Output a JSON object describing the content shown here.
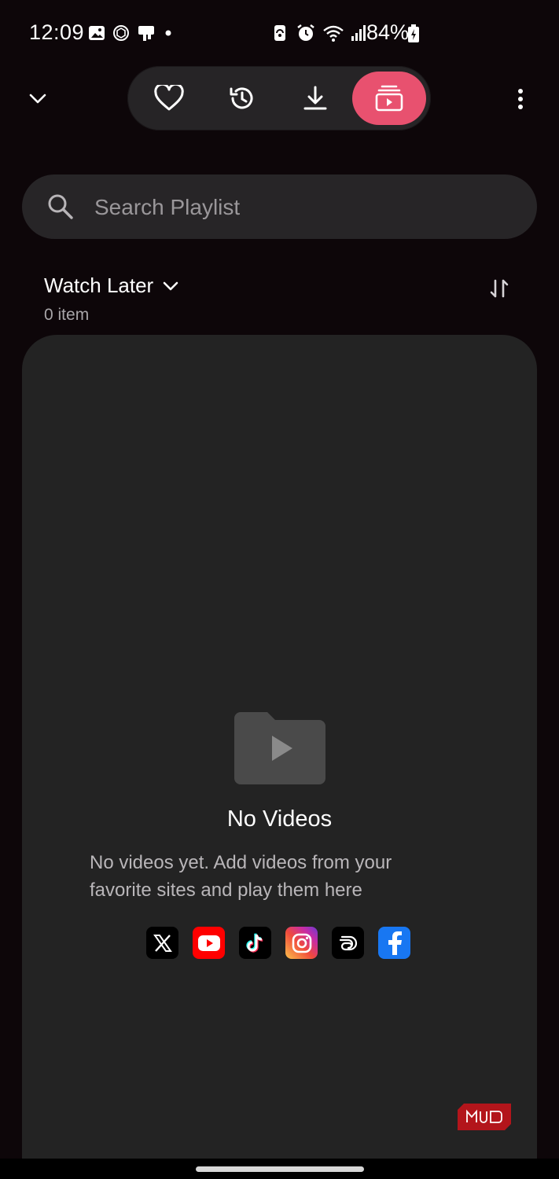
{
  "status_bar": {
    "time": "12:09",
    "battery": "84%"
  },
  "toolbar": {
    "tabs": [
      {
        "name": "favorites",
        "icon": "heart-icon"
      },
      {
        "name": "history",
        "icon": "history-icon"
      },
      {
        "name": "downloads",
        "icon": "download-icon"
      },
      {
        "name": "playlist",
        "icon": "playlist-play-icon",
        "active": true
      }
    ],
    "accent_color": "#e8516f"
  },
  "search": {
    "placeholder": "Search Playlist",
    "value": ""
  },
  "playlist": {
    "title": "Watch Later",
    "count": "0 item"
  },
  "empty_state": {
    "title": "No Videos",
    "description": "No videos yet. Add videos from your favorite sites and play them here"
  },
  "sites": [
    {
      "name": "x",
      "icon": "x-logo-icon"
    },
    {
      "name": "youtube",
      "icon": "youtube-logo-icon"
    },
    {
      "name": "tiktok",
      "icon": "tiktok-logo-icon"
    },
    {
      "name": "instagram",
      "icon": "instagram-logo-icon"
    },
    {
      "name": "threads-like",
      "icon": "swirl-logo-icon"
    },
    {
      "name": "facebook",
      "icon": "facebook-logo-icon"
    }
  ],
  "watermark": {
    "text": "MUO"
  }
}
